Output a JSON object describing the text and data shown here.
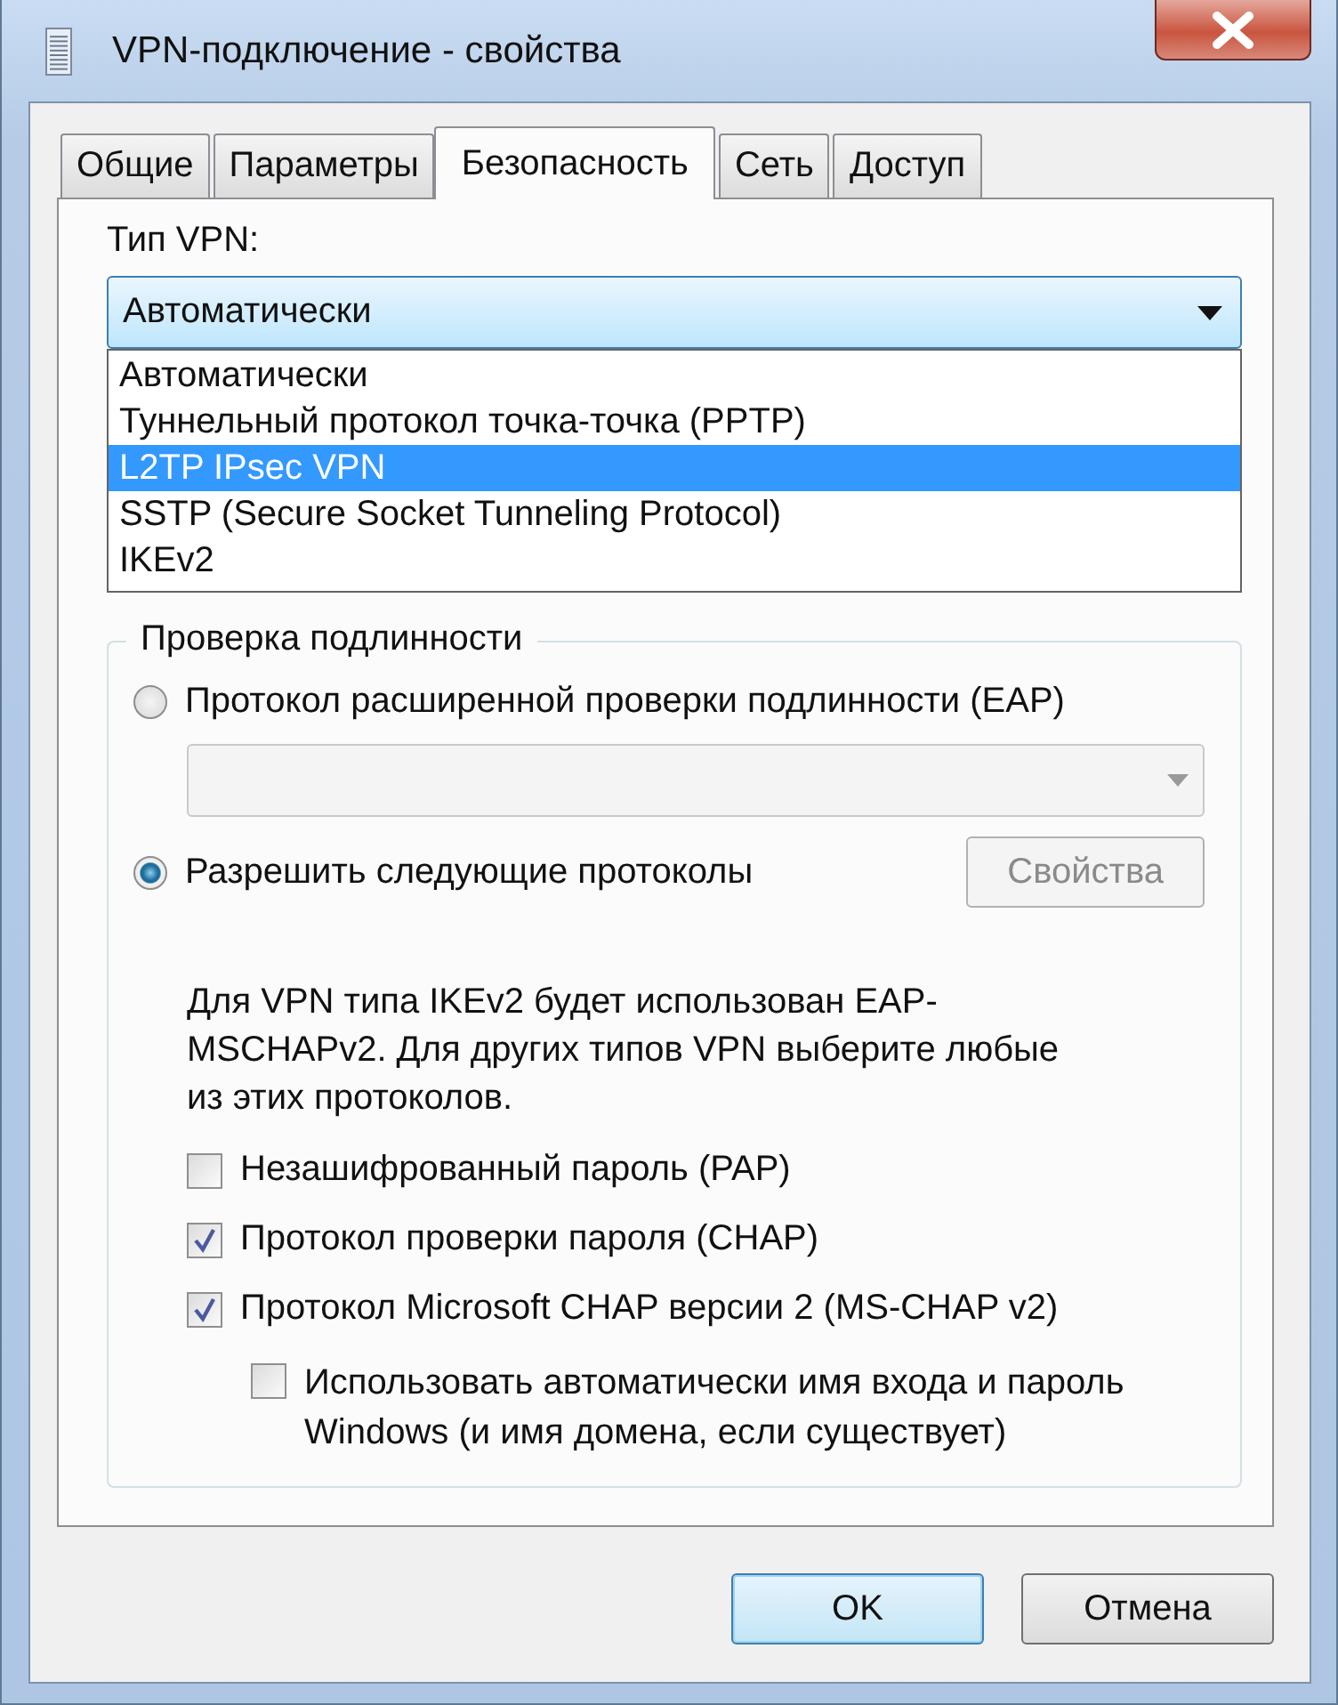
{
  "window": {
    "title": "VPN-подключение - свойства"
  },
  "tabs": [
    {
      "label": "Общие",
      "selected": false
    },
    {
      "label": "Параметры",
      "selected": false
    },
    {
      "label": "Безопасность",
      "selected": true
    },
    {
      "label": "Сеть",
      "selected": false
    },
    {
      "label": "Доступ",
      "selected": false
    }
  ],
  "vpn_type": {
    "label": "Тип VPN:",
    "value": "Автоматически",
    "expanded": true,
    "options": [
      {
        "label": "Автоматически",
        "highlighted": false
      },
      {
        "label": "Туннельный протокол точка-точка (PPTP)",
        "highlighted": false
      },
      {
        "label": "L2TP IPsec VPN",
        "highlighted": true
      },
      {
        "label": "SSTP (Secure Socket Tunneling Protocol)",
        "highlighted": false
      },
      {
        "label": "IKEv2",
        "highlighted": false
      }
    ]
  },
  "authentication": {
    "title": "Проверка подлинности",
    "eap": {
      "label": "Протокол расширенной проверки подлинности (EAP)",
      "selected": false
    },
    "eap_method": {
      "disabled": true
    },
    "allow": {
      "label": "Разрешить следующие протоколы",
      "selected": true
    },
    "properties_button": {
      "label": "Свойства",
      "disabled": true
    },
    "note": "Для VPN типа IKEv2 будет использован EAP-MSCHAPv2. Для других типов VPN выберите любые из этих протоколов.",
    "protocols": [
      {
        "label": "Незашифрованный пароль (PAP)",
        "checked": false
      },
      {
        "label": "Протокол проверки пароля (CHAP)",
        "checked": true
      },
      {
        "label": "Протокол Microsoft CHAP версии 2 (MS-CHAP v2)",
        "checked": true,
        "children": [
          {
            "label": "Использовать автоматически имя входа и пароль Windows (и имя домена, если существует)",
            "checked": false
          }
        ]
      }
    ]
  },
  "buttons": [
    {
      "label": "OK",
      "kind": "default"
    },
    {
      "label": "Отмена",
      "kind": "normal"
    }
  ]
}
